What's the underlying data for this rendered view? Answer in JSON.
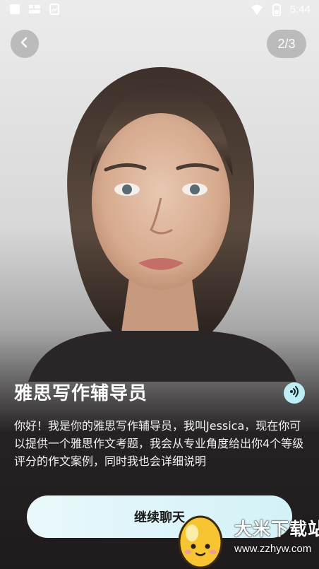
{
  "status_bar": {
    "time": "5:44",
    "left_icons": [
      "square-icon",
      "tile-icon",
      "photo-icon"
    ],
    "right_icons": [
      "wifi-icon",
      "battery-icon"
    ]
  },
  "header": {
    "back_icon": "chevron-left-icon",
    "page_indicator": "2/3"
  },
  "assistant": {
    "title": "雅思写作辅导员",
    "audio_icon": "speaker-icon",
    "description": "你好！我是你的雅思写作辅导员，我叫Jessica，现在你可以提供一个雅思作文考题，我会从专业角度给出你4个等级评分的作文案例，同时我也会详细说明"
  },
  "actions": {
    "continue_label": "继续聊天"
  },
  "watermark": {
    "brand": "大米下载站",
    "url": "www.zzhyw.com"
  },
  "colors": {
    "accent": "#bdeef6",
    "button_bg": "#d9f4f9",
    "panel_bg": "#1f1b1d",
    "text_light": "#ffffff"
  }
}
